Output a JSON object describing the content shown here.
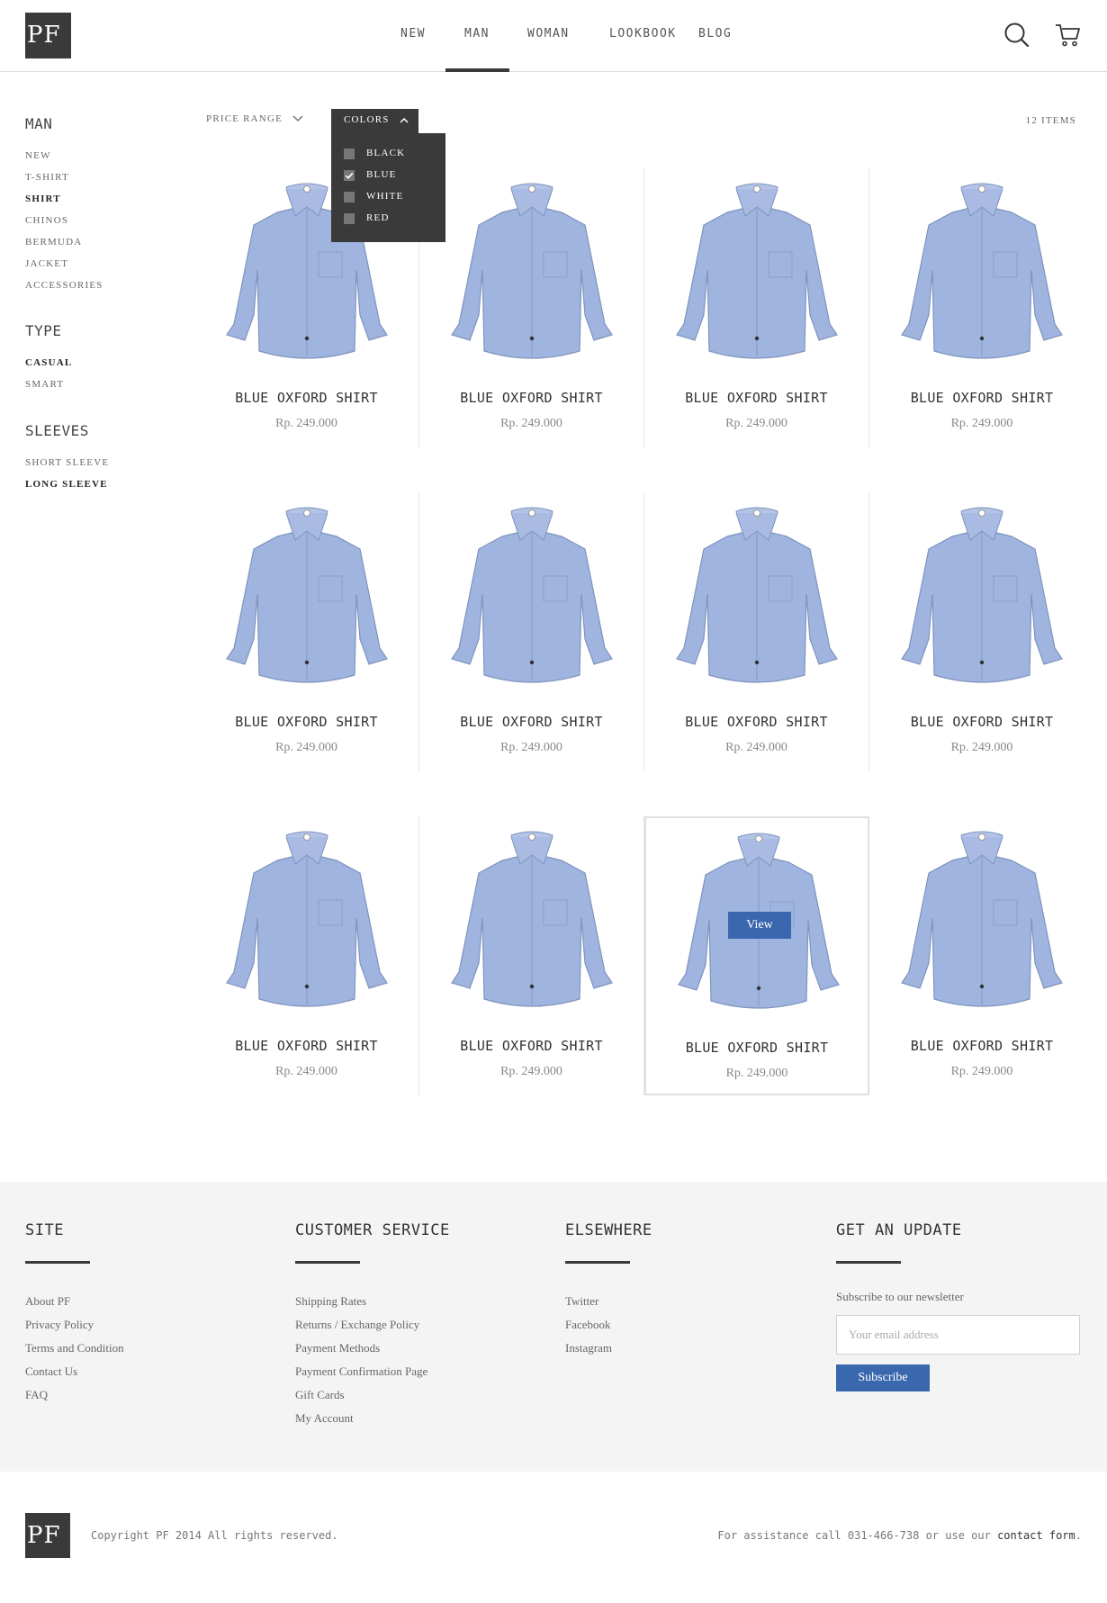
{
  "brand": {
    "logo_text": "PF"
  },
  "nav": {
    "items": [
      {
        "label": "NEW"
      },
      {
        "label": "MAN"
      },
      {
        "label": "WOMAN"
      },
      {
        "label": "LOOKBOOK"
      },
      {
        "label": "BLOG"
      }
    ],
    "active": "MAN"
  },
  "icons": {
    "search": "search-icon",
    "cart": "cart-icon"
  },
  "sidebar": {
    "sections": [
      {
        "title": "MAN",
        "items": [
          {
            "label": "NEW",
            "active": false
          },
          {
            "label": "T-SHIRT",
            "active": false
          },
          {
            "label": "SHIRT",
            "active": true
          },
          {
            "label": "CHINOS",
            "active": false
          },
          {
            "label": "BERMUDA",
            "active": false
          },
          {
            "label": "JACKET",
            "active": false
          },
          {
            "label": "ACCESSORIES",
            "active": false
          }
        ]
      },
      {
        "title": "TYPE",
        "items": [
          {
            "label": "CASUAL",
            "active": true
          },
          {
            "label": "SMART",
            "active": false
          }
        ]
      },
      {
        "title": "SLEEVES",
        "items": [
          {
            "label": "SHORT SLEEVE",
            "active": false
          },
          {
            "label": "LONG SLEEVE",
            "active": true
          }
        ]
      }
    ]
  },
  "filters": {
    "price_label": "PRICE RANGE",
    "colors_label": "COLORS",
    "color_options": [
      {
        "label": "BLACK",
        "checked": false
      },
      {
        "label": "BLUE",
        "checked": true
      },
      {
        "label": "WHITE",
        "checked": false
      },
      {
        "label": "RED",
        "checked": false
      }
    ],
    "items_count": "12 ITEMS"
  },
  "products": [
    {
      "name": "BLUE OXFORD SHIRT",
      "price": "Rp. 249.000"
    },
    {
      "name": "BLUE OXFORD SHIRT",
      "price": "Rp. 249.000"
    },
    {
      "name": "BLUE OXFORD SHIRT",
      "price": "Rp. 249.000"
    },
    {
      "name": "BLUE OXFORD SHIRT",
      "price": "Rp. 249.000"
    },
    {
      "name": "BLUE OXFORD SHIRT",
      "price": "Rp. 249.000"
    },
    {
      "name": "BLUE OXFORD SHIRT",
      "price": "Rp. 249.000"
    },
    {
      "name": "BLUE OXFORD SHIRT",
      "price": "Rp. 249.000"
    },
    {
      "name": "BLUE OXFORD SHIRT",
      "price": "Rp. 249.000"
    },
    {
      "name": "BLUE OXFORD SHIRT",
      "price": "Rp. 249.000"
    },
    {
      "name": "BLUE OXFORD SHIRT",
      "price": "Rp. 249.000"
    },
    {
      "name": "BLUE OXFORD SHIRT",
      "price": "Rp. 249.000",
      "hovered": true,
      "view_label": "View"
    },
    {
      "name": "BLUE OXFORD SHIRT",
      "price": "Rp. 249.000"
    }
  ],
  "footer": {
    "site": {
      "title": "SITE",
      "links": [
        "About PF",
        "Privacy Policy",
        "Terms and Condition",
        "Contact Us",
        "FAQ"
      ]
    },
    "service": {
      "title": "CUSTOMER SERVICE",
      "links": [
        "Shipping Rates",
        "Returns / Exchange Policy",
        "Payment Methods",
        "Payment Confirmation Page",
        "Gift Cards",
        "My Account"
      ]
    },
    "elsewhere": {
      "title": "ELSEWHERE",
      "links": [
        "Twitter",
        "Facebook",
        "Instagram"
      ]
    },
    "update": {
      "title": "GET AN UPDATE",
      "text": "Subscribe to our newsletter",
      "placeholder": "Your email address",
      "button": "Subscribe"
    }
  },
  "bottom": {
    "logo_text": "PF",
    "copyright": "Copyright PF 2014 All rights reserved.",
    "assist_text": "For assistance call 031-466-738 or use our ",
    "assist_link": "contact form",
    "assist_end": "."
  },
  "colors": {
    "dark": "#3a3a3a",
    "accent": "#3a68ae",
    "footer_bg": "#f4f4f4",
    "shirt": "#9fb4de"
  }
}
